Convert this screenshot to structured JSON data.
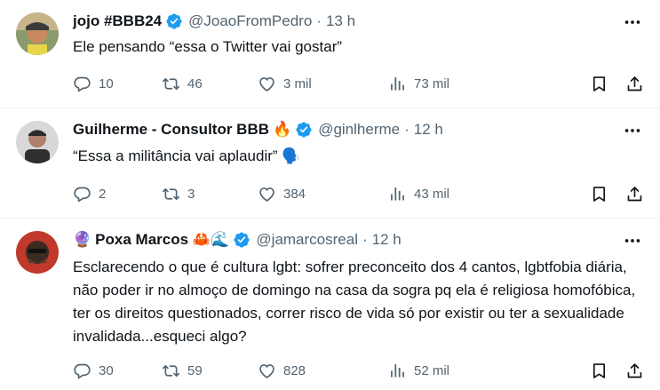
{
  "tweets": [
    {
      "name": "jojo #BBB24",
      "handle": "@JoaoFromPedro",
      "dot": "·",
      "time": "13 h",
      "name_emoji": "",
      "text": "Ele pensando “essa o Twitter vai gostar”",
      "replies": "10",
      "retweets": "46",
      "likes": "3 mil",
      "views": "73 mil"
    },
    {
      "name": "Guilherme - Consultor BBB",
      "handle": "@ginlherme",
      "dot": "·",
      "time": "12 h",
      "name_emoji": "🔥",
      "text": "“Essa a militância vai aplaudir” 🗣️",
      "replies": "2",
      "retweets": "3",
      "likes": "384",
      "views": "43 mil"
    },
    {
      "name": "Poxa Marcos",
      "handle": "@jamarcosreal",
      "dot": "·",
      "time": "12 h",
      "name_prefix_emoji": "🔮",
      "name_emoji": "🦀🌊",
      "text": "Esclarecendo o que é cultura lgbt: sofrer preconceito dos 4 cantos, lgbtfobia diária, não poder ir no almoço de domingo na casa da sogra pq ela é religiosa homofóbica, ter os direitos questionados, correr risco de vida só por existir ou ter a sexualidade invalidada...esqueci algo?",
      "replies": "30",
      "retweets": "59",
      "likes": "828",
      "views": "52 mil"
    }
  ],
  "colors": {
    "verified": "#1d9bf0",
    "muted": "#536471",
    "text": "#0f1419",
    "divider": "#eff3f4"
  },
  "icons": [
    "verified-badge-icon",
    "more-icon",
    "reply-icon",
    "retweet-icon",
    "like-icon",
    "views-icon",
    "bookmark-icon",
    "share-icon"
  ]
}
